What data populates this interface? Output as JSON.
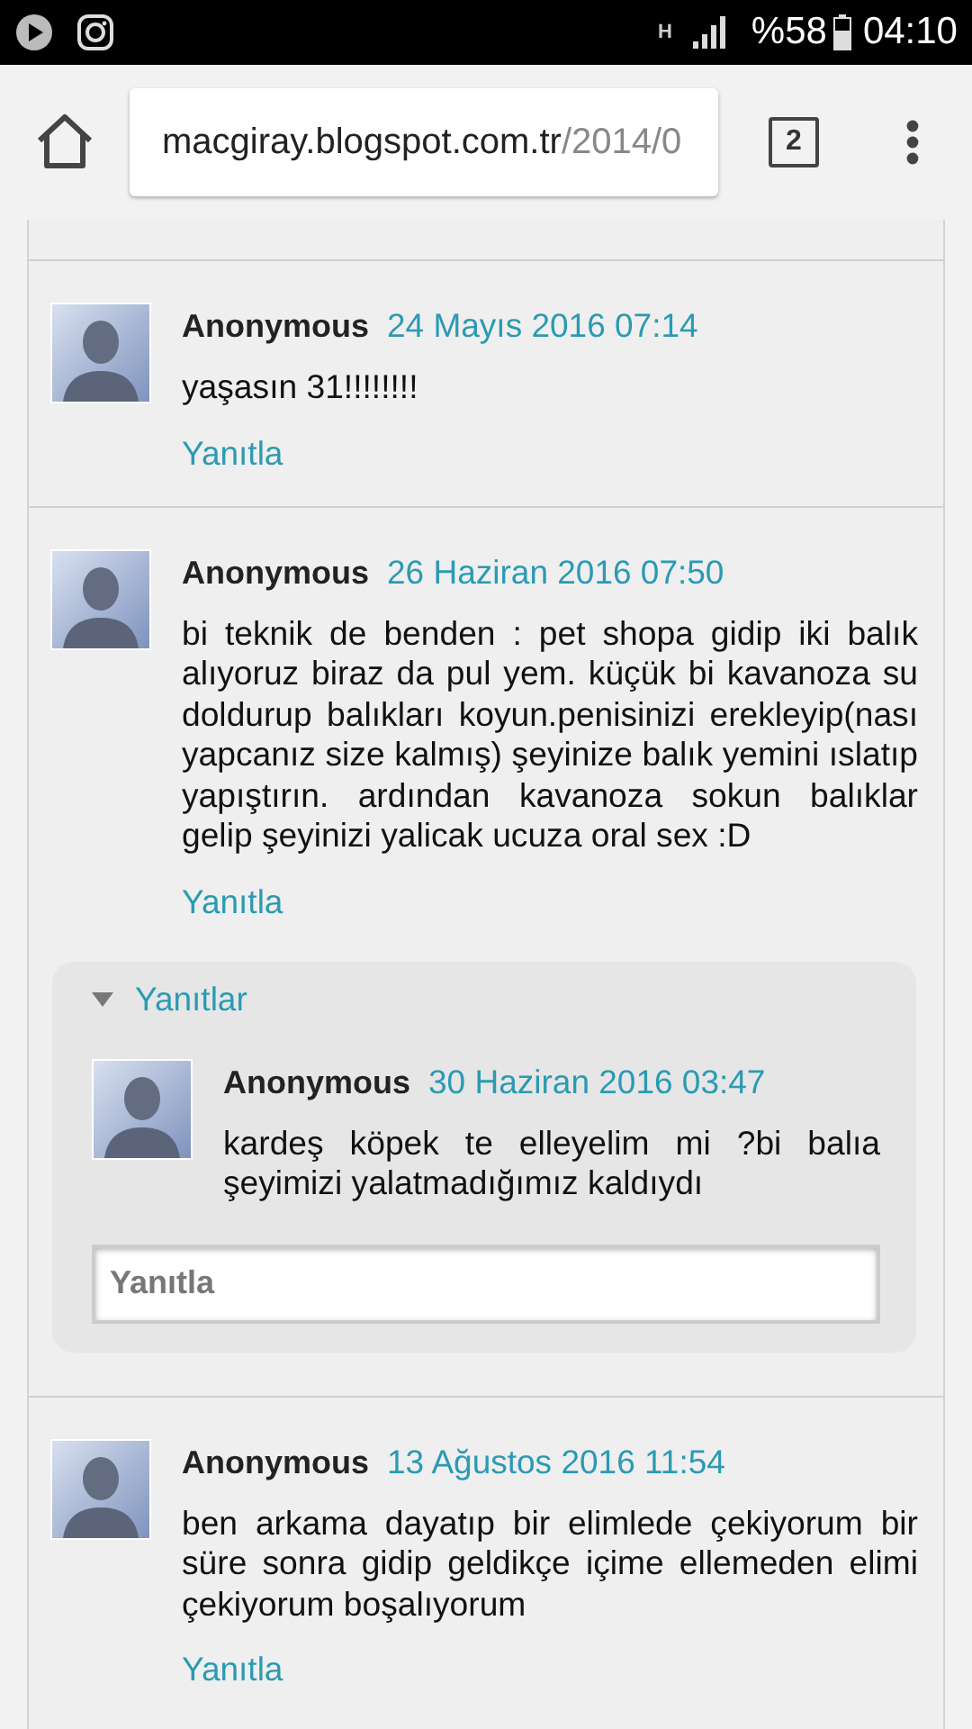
{
  "status_bar": {
    "network": "H",
    "battery": "%58",
    "time": "04:10"
  },
  "browser": {
    "url_host": "macgiray.blogspot.com.tr",
    "url_path": "/2014/0",
    "tab_count": "2"
  },
  "comments": [
    {
      "author": "Anonymous",
      "date": "24 Mayıs 2016 07:14",
      "text": "yaşasın 31!!!!!!!!",
      "reply_link": "Yanıtla"
    },
    {
      "author": "Anonymous",
      "date": "26 Haziran 2016 07:50",
      "text": "bi teknik de benden : pet shopa gidip iki balık alıyoruz biraz da pul yem. küçük bi kavanoza su doldurup balıkları koyun.penisinizi erekleyip(nası yapcanız size kalmış) şeyinize balık yemini ıslatıp yapıştırın. ardından kavanoza sokun balıklar gelip şeyinizi yalicak ucuza oral sex :D",
      "reply_link": "Yanıtla",
      "replies": {
        "toggle_label": "Yanıtlar",
        "expanded": true,
        "items": [
          {
            "author": "Anonymous",
            "date": "30 Haziran 2016 03:47",
            "text": "kardeş köpek te elleyelim mi ?bi balıa şeyimizi yalatmadığımız kaldıydı"
          }
        ],
        "reply_field": {
          "placeholder": "Yanıtla"
        }
      }
    },
    {
      "author": "Anonymous",
      "date": "13 Ağustos 2016 11:54",
      "text": "ben arkama dayatıp bir elimlede çekiyorum bir süre sonra gidip geldikçe içime ellemeden elimi çekiyorum boşalıyorum",
      "reply_link": "Yanıtla"
    }
  ]
}
